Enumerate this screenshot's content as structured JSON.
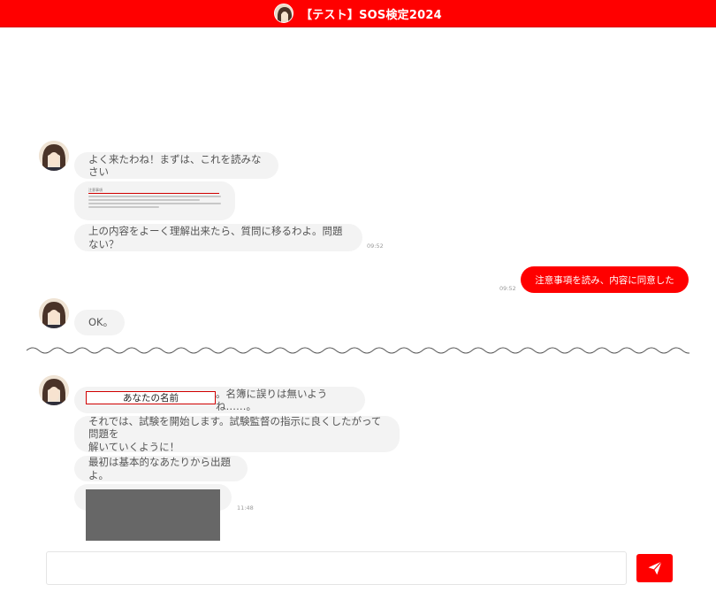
{
  "header": {
    "title": "【テスト】SOS検定2024"
  },
  "messages": {
    "m1": {
      "text": "よく来たわね！まずは、これを読みなさい"
    },
    "doc": {
      "title": "注意事項"
    },
    "m3": {
      "text": "上の内容をよーく理解出来たら、質問に移るわよ。問題ない？",
      "time": "09:52"
    },
    "user": {
      "text": "注意事項を読み、内容に同意した",
      "time": "09:52"
    },
    "m4": {
      "text": "OK。"
    },
    "m5": {
      "name": "あなたの名前",
      "text": "。名簿に誤りは無いようね……。"
    },
    "m6": {
      "line1": "それでは、試験を開始します。試験監督の指示に良くしたがって問題を",
      "line2": "解いていくように！"
    },
    "m7": {
      "text": "最初は基本的なあたりから出題よ。"
    },
    "m8": {
      "time": "11:48"
    }
  },
  "footer": {
    "placeholder": "",
    "send_icon": "paper-plane-icon"
  },
  "colors": {
    "accent": "#ff0000",
    "bubble": "#f3f3f3",
    "text": "#555555"
  }
}
